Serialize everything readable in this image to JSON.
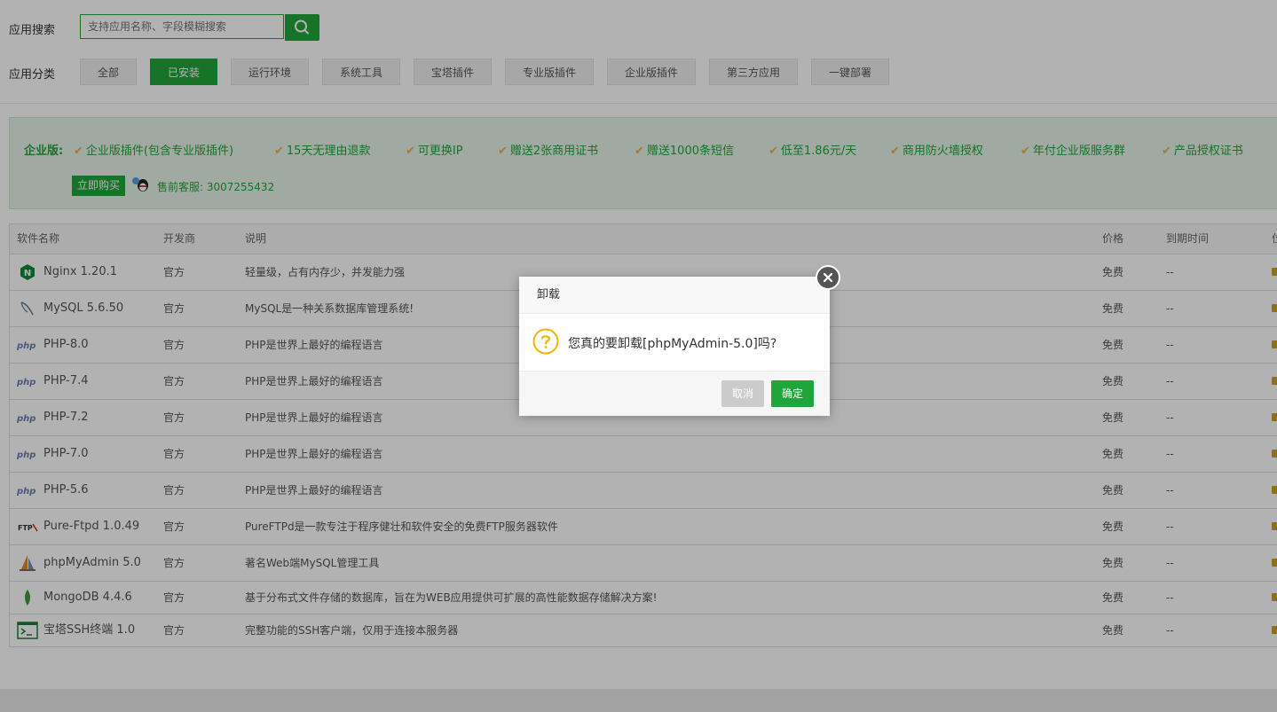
{
  "search": {
    "label": "应用搜索",
    "placeholder": "支持应用名称、字段模糊搜索"
  },
  "category": {
    "label": "应用分类",
    "tabs": [
      "全部",
      "已安装",
      "运行环境",
      "系统工具",
      "宝塔插件",
      "专业版插件",
      "企业版插件",
      "第三方应用",
      "一键部署"
    ],
    "active": "已安装"
  },
  "promo": {
    "title": "企业版:",
    "features": [
      "企业版插件(包含专业版插件)",
      "15天无理由退款",
      "可更换IP",
      "赠送2张商用证书",
      "赠送1000条短信",
      "低至1.86元/天",
      "商用防火墙授权",
      "年付企业版服务群",
      "产品授权证书"
    ],
    "buy_label": "立即购买",
    "service": "售前客服: 3007255432"
  },
  "table": {
    "headers": {
      "name": "软件名称",
      "dev": "开发商",
      "desc": "说明",
      "price": "价格",
      "expire": "到期时间",
      "extra": "位"
    },
    "rows": [
      {
        "icon": "nginx-icon",
        "name": "Nginx 1.20.1",
        "dev": "官方",
        "desc": "轻量级，占有内存少，并发能力强",
        "price": "免费",
        "expire": "--"
      },
      {
        "icon": "mysql-icon",
        "name": "MySQL 5.6.50",
        "dev": "官方",
        "desc": "MySQL是一种关系数据库管理系统!",
        "price": "免费",
        "expire": "--"
      },
      {
        "icon": "php-icon",
        "name": "PHP-8.0",
        "dev": "官方",
        "desc": "PHP是世界上最好的编程语言",
        "price": "免费",
        "expire": "--"
      },
      {
        "icon": "php-icon",
        "name": "PHP-7.4",
        "dev": "官方",
        "desc": "PHP是世界上最好的编程语言",
        "price": "免费",
        "expire": "--"
      },
      {
        "icon": "php-icon",
        "name": "PHP-7.2",
        "dev": "官方",
        "desc": "PHP是世界上最好的编程语言",
        "price": "免费",
        "expire": "--"
      },
      {
        "icon": "php-icon",
        "name": "PHP-7.0",
        "dev": "官方",
        "desc": "PHP是世界上最好的编程语言",
        "price": "免费",
        "expire": "--"
      },
      {
        "icon": "php-icon",
        "name": "PHP-5.6",
        "dev": "官方",
        "desc": "PHP是世界上最好的编程语言",
        "price": "免费",
        "expire": "--"
      },
      {
        "icon": "ftp-icon",
        "name": "Pure-Ftpd 1.0.49",
        "dev": "官方",
        "desc": "PureFTPd是一款专注于程序健壮和软件安全的免费FTP服务器软件",
        "price": "免费",
        "expire": "--"
      },
      {
        "icon": "phpmyadmin-icon",
        "name": "phpMyAdmin 5.0",
        "dev": "官方",
        "desc": "著名Web端MySQL管理工具",
        "price": "免费",
        "expire": "--"
      },
      {
        "icon": "mongodb-icon",
        "name": "MongoDB 4.4.6",
        "dev": "官方",
        "desc": "基于分布式文件存储的数据库，旨在为WEB应用提供可扩展的高性能数据存储解决方案!",
        "price": "免费",
        "expire": "--"
      },
      {
        "icon": "terminal-icon",
        "name": "宝塔SSH终端 1.0",
        "dev": "官方",
        "desc": "完整功能的SSH客户端，仅用于连接本服务器",
        "price": "免费",
        "expire": "--"
      }
    ]
  },
  "dialog": {
    "title": "卸载",
    "message": "您真的要卸载[phpMyAdmin-5.0]吗?",
    "cancel": "取消",
    "confirm": "确定"
  },
  "colors": {
    "accent": "#20a53a",
    "check": "#f0ad4e",
    "promo_bg": "#e6f4e8"
  }
}
